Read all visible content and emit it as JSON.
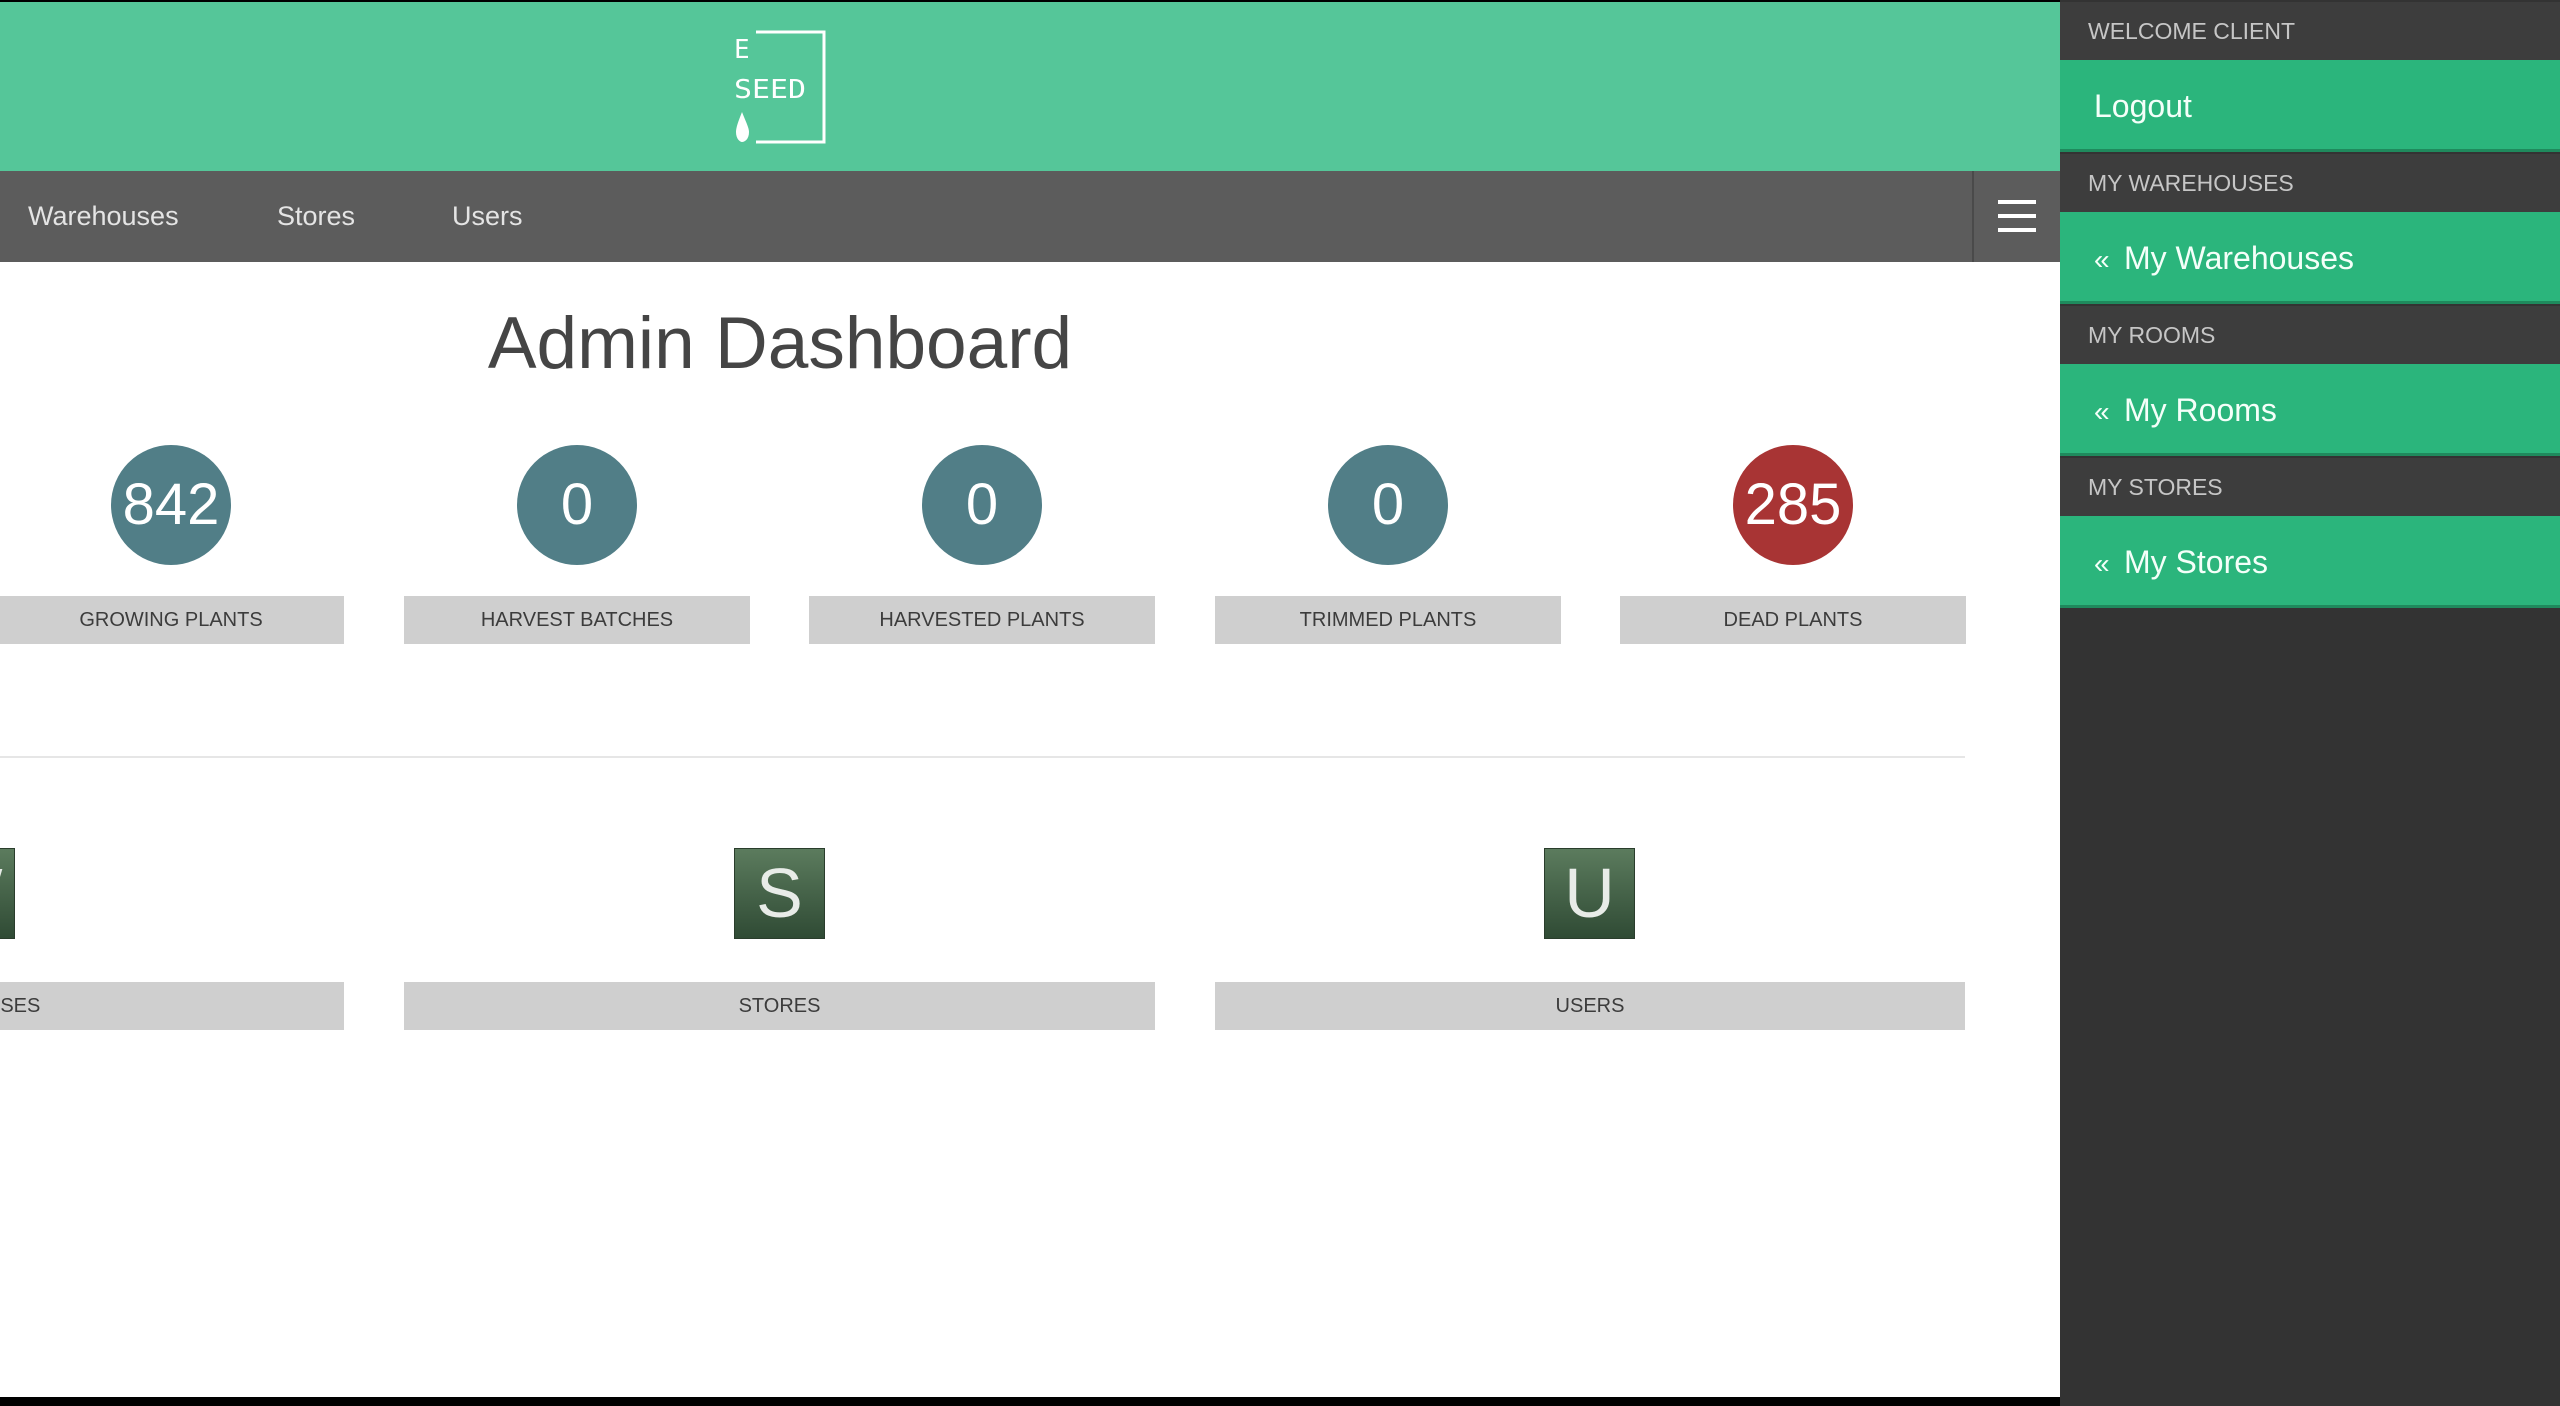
{
  "header": {
    "logo_letters": [
      "E",
      "SEED"
    ]
  },
  "nav": {
    "links": [
      "Warehouses",
      "Stores",
      "Users"
    ]
  },
  "page": {
    "title": "Admin Dashboard"
  },
  "stats": [
    {
      "value": "842",
      "label": "GROWING PLANTS",
      "color": "#517e87"
    },
    {
      "value": "0",
      "label": "HARVEST BATCHES",
      "color": "#517e87"
    },
    {
      "value": "0",
      "label": "HARVESTED PLANTS",
      "color": "#517e87"
    },
    {
      "value": "0",
      "label": "TRIMMED PLANTS",
      "color": "#517e87"
    },
    {
      "value": "285",
      "label": "DEAD PLANTS",
      "color": "#a83434"
    }
  ],
  "sections": [
    {
      "letter": "W",
      "label": "WAREHOUSES"
    },
    {
      "letter": "S",
      "label": "STORES"
    },
    {
      "letter": "U",
      "label": "USERS"
    }
  ],
  "sidebar": {
    "welcome": "WELCOME CLIENT",
    "logout": "Logout",
    "groups": [
      {
        "header": "MY WAREHOUSES",
        "chevron": "«",
        "item": "My Warehouses"
      },
      {
        "header": "MY ROOMS",
        "chevron": "«",
        "item": "My Rooms"
      },
      {
        "header": "MY STORES",
        "chevron": "«",
        "item": "My Stores"
      }
    ]
  },
  "colors": {
    "header_green": "#55c699",
    "sidebar_green": "#2bb57c",
    "navbar_gray": "#5c5c5c",
    "stat_teal": "#517e87",
    "stat_red": "#a83434"
  },
  "icons": {
    "menu": "hamburger-menu-icon",
    "logo": "eseed-logo-icon"
  }
}
